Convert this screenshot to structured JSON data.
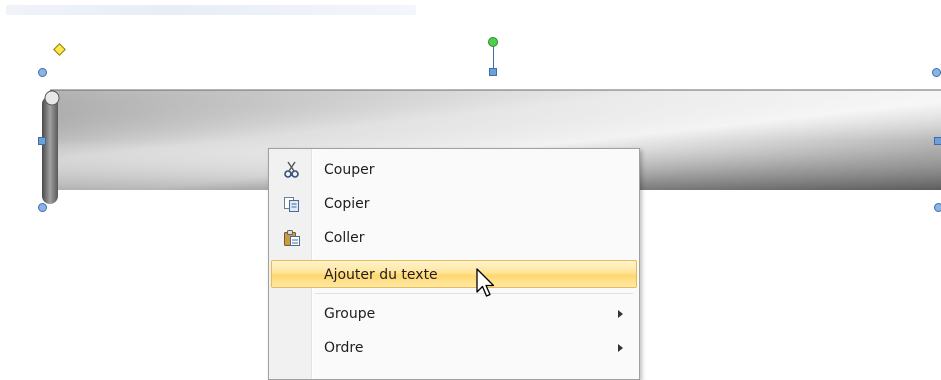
{
  "context_menu": {
    "items": [
      {
        "label": "Couper",
        "icon": "scissors-icon"
      },
      {
        "label": "Copier",
        "icon": "copy-icon"
      },
      {
        "label": "Coller",
        "icon": "paste-icon"
      },
      {
        "label": "Ajouter du texte",
        "icon": "",
        "highlighted": true
      },
      {
        "label": "Groupe",
        "icon": "",
        "submenu": true
      },
      {
        "label": "Ordre",
        "icon": "",
        "submenu": true
      }
    ]
  },
  "colors": {
    "highlight": "#ffe49a",
    "selection_handle": "#6ea0d8",
    "rotation_handle": "#4fd04a",
    "adjust_handle": "#ffe94a"
  }
}
